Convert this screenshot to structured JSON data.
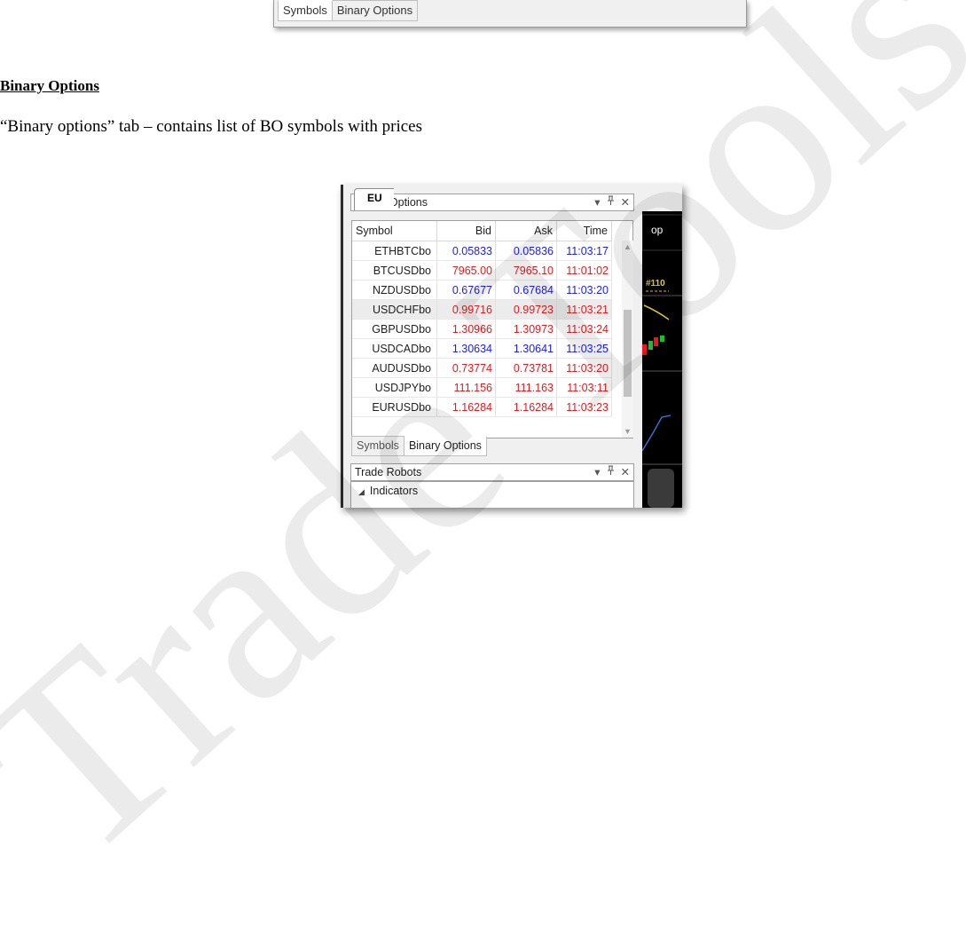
{
  "top_tabs": [
    {
      "label": "Symbols",
      "active": true
    },
    {
      "label": "Binary Options",
      "active": false
    }
  ],
  "heading": "Binary Options",
  "paragraph": "“Binary options” tab – contains list of BO symbols with prices",
  "panel": {
    "title": "Binary Options",
    "controls": {
      "dropdown": "▾",
      "pin": "ᵖ",
      "close": "✕"
    },
    "columns": {
      "symbol": "Symbol",
      "bid": "Bid",
      "ask": "Ask",
      "time": "Time"
    },
    "rows": [
      {
        "symbol": "ETHBTCbo",
        "bid": "0.05833",
        "ask": "0.05836",
        "time": "11:03:17",
        "dir": "up"
      },
      {
        "symbol": "BTCUSDbo",
        "bid": "7965.00",
        "ask": "7965.10",
        "time": "11:01:02",
        "dir": "down"
      },
      {
        "symbol": "NZDUSDbo",
        "bid": "0.67677",
        "ask": "0.67684",
        "time": "11:03:20",
        "dir": "up"
      },
      {
        "symbol": "USDCHFbo",
        "bid": "0.99716",
        "ask": "0.99723",
        "time": "11:03:21",
        "dir": "down"
      },
      {
        "symbol": "GBPUSDbo",
        "bid": "1.30966",
        "ask": "1.30973",
        "time": "11:03:24",
        "dir": "down"
      },
      {
        "symbol": "USDCADbo",
        "bid": "1.30634",
        "ask": "1.30641",
        "time": "11:03:25",
        "dir": "up"
      },
      {
        "symbol": "AUDUSDbo",
        "bid": "0.73774",
        "ask": "0.73781",
        "time": "11:03:20",
        "dir": "down"
      },
      {
        "symbol": "USDJPYbo",
        "bid": "111.156",
        "ask": "111.163",
        "time": "11:03:11",
        "dir": "down"
      },
      {
        "symbol": "EURUSDbo",
        "bid": "1.16284",
        "ask": "1.16284",
        "time": "11:03:23",
        "dir": "down"
      }
    ],
    "selected_row": 3,
    "tabs": [
      {
        "label": "Symbols",
        "active": false
      },
      {
        "label": "Binary Options",
        "active": true
      }
    ]
  },
  "robots_panel": {
    "title": "Trade Robots",
    "node": "Indicators"
  },
  "chart": {
    "tab_label": "EU",
    "label": "op",
    "order_tag": "#110"
  },
  "watermark": "Trade Tools FX",
  "colors": {
    "down": "#e8171b",
    "up": "#1a1aff",
    "chart_bg": "#000000"
  }
}
